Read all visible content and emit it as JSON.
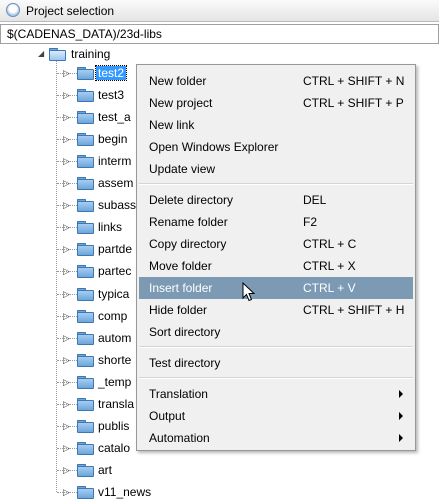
{
  "window": {
    "title": "Project selection"
  },
  "path": {
    "value": "$(CADENAS_DATA)/23d-libs"
  },
  "tree": {
    "root": {
      "label": "training",
      "expanded": true
    },
    "children": [
      {
        "label": "test2",
        "selected": true
      },
      {
        "label": "test3"
      },
      {
        "label": "test_a"
      },
      {
        "label": "begin"
      },
      {
        "label": "interm"
      },
      {
        "label": "assem"
      },
      {
        "label": "subass"
      },
      {
        "label": "links"
      },
      {
        "label": "partde"
      },
      {
        "label": "partec"
      },
      {
        "label": "typica"
      },
      {
        "label": "comp"
      },
      {
        "label": "autom"
      },
      {
        "label": "shorte"
      },
      {
        "label": "_temp"
      },
      {
        "label": "transla"
      },
      {
        "label": "publis"
      },
      {
        "label": "catalo"
      },
      {
        "label": "art"
      },
      {
        "label": "v11_news"
      }
    ]
  },
  "context_menu": {
    "items": [
      {
        "label": "New folder",
        "shortcut": "CTRL + SHIFT + N",
        "name": "new-folder"
      },
      {
        "label": "New project",
        "shortcut": "CTRL + SHIFT + P",
        "name": "new-project"
      },
      {
        "label": "New link",
        "shortcut": "",
        "name": "new-link"
      },
      {
        "label": "Open Windows Explorer",
        "shortcut": "",
        "name": "open-windows-explorer"
      },
      {
        "label": "Update view",
        "shortcut": "",
        "name": "update-view"
      },
      {
        "separator": true
      },
      {
        "label": "Delete directory",
        "shortcut": "DEL",
        "name": "delete-directory"
      },
      {
        "label": "Rename folder",
        "shortcut": "F2",
        "name": "rename-folder"
      },
      {
        "label": "Copy directory",
        "shortcut": "CTRL + C",
        "name": "copy-directory"
      },
      {
        "label": "Move folder",
        "shortcut": "CTRL + X",
        "name": "move-folder"
      },
      {
        "label": "Insert folder",
        "shortcut": "CTRL + V",
        "name": "insert-folder",
        "highlighted": true
      },
      {
        "label": "Hide folder",
        "shortcut": "CTRL + SHIFT + H",
        "name": "hide-folder"
      },
      {
        "label": "Sort directory",
        "shortcut": "",
        "name": "sort-directory"
      },
      {
        "separator": true
      },
      {
        "label": "Test directory",
        "shortcut": "",
        "name": "test-directory"
      },
      {
        "separator": true
      },
      {
        "label": "Translation",
        "shortcut": "",
        "name": "translation",
        "submenu": true
      },
      {
        "label": "Output",
        "shortcut": "",
        "name": "output",
        "submenu": true
      },
      {
        "label": "Automation",
        "shortcut": "",
        "name": "automation",
        "submenu": true
      }
    ]
  },
  "colors": {
    "selection": "#3399ff",
    "menu_highlight": "#7c9ab4",
    "menu_background": "#f0f0f0",
    "folder": "#6da6dc"
  }
}
